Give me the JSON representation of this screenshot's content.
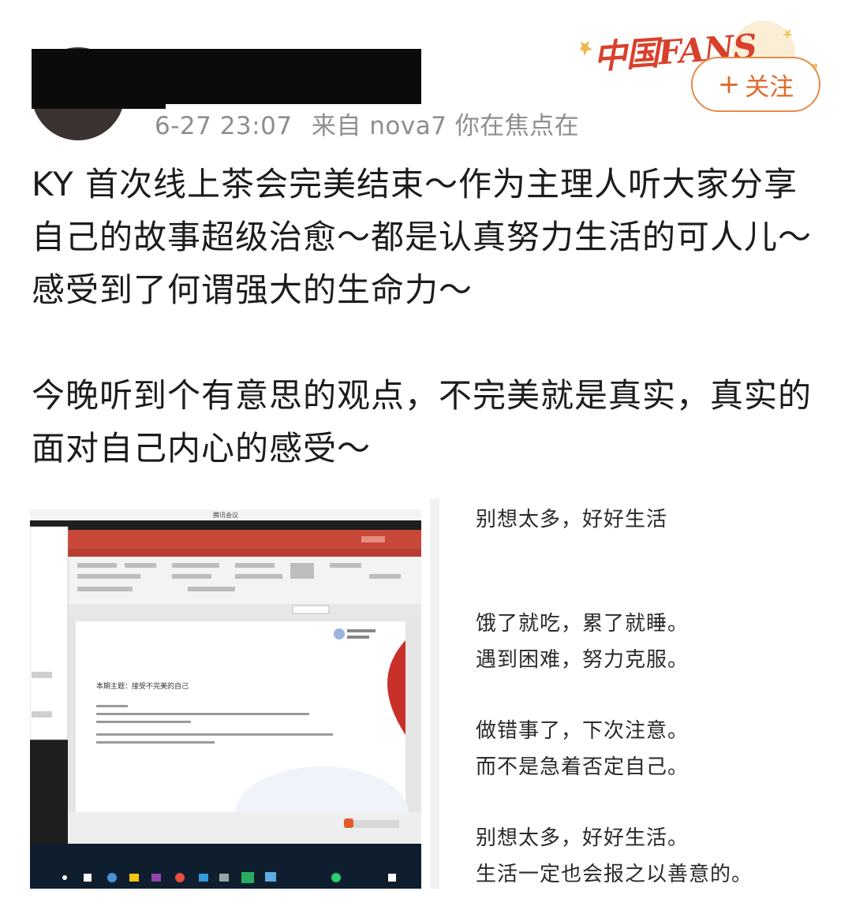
{
  "post": {
    "timestamp": "6-27 23:07",
    "source_prefix": "来自",
    "source": "nova7 你在焦点在",
    "follow_label": "关注",
    "follow_plus": "+",
    "badge": "中国FANS",
    "paragraphs": [
      "KY 首次线上茶会完美结束～作为主理人听大家分享自己的故事超级治愈～都是认真努力生活的可人儿～感受到了何谓强大的生命力～",
      "今晚听到个有意思的观点，不完美就是真实，真实的面对自己内心的感受～"
    ]
  },
  "image_left": {
    "window_title": "腾讯会议",
    "slide_heading": "本期主题：接受不完美的自己"
  },
  "image_right": {
    "lines": [
      "别想太多，好好生活",
      "饿了就吃，累了就睡。",
      "遇到困难，努力克服。",
      "做错事了，下次注意。",
      "而不是急着否定自己。",
      "别想太多，好好生活。",
      "生活一定也会报之以善意的。"
    ]
  },
  "colors": {
    "accent": "#e06a2a",
    "meta": "#8e8e8e",
    "ppt_red": "#c8483a"
  }
}
